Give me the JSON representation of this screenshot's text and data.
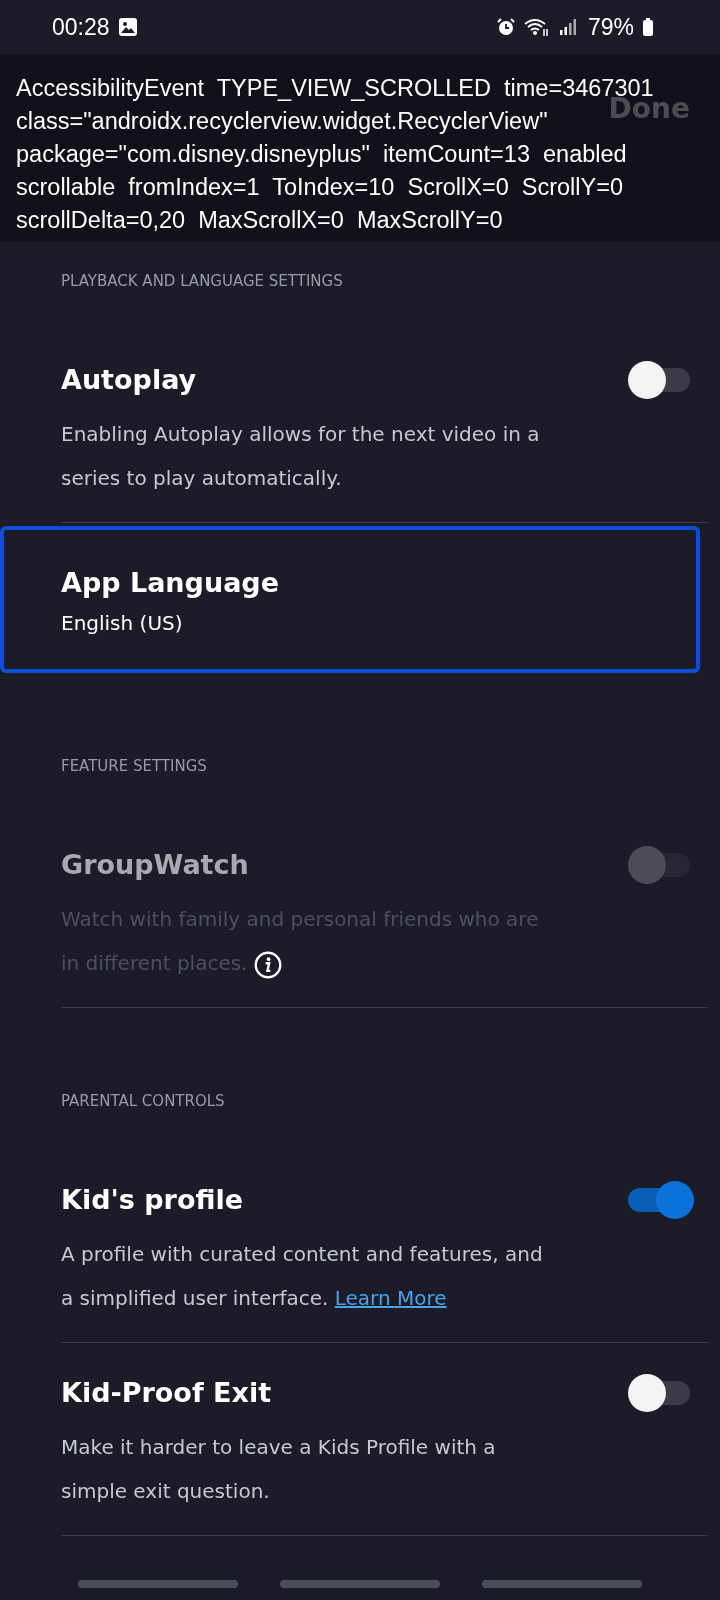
{
  "status_bar": {
    "time": "00:28",
    "battery": "79%"
  },
  "header": {
    "action": "Done"
  },
  "debug_overlay": {
    "lines": [
      "AccessibilityEvent  TYPE_VIEW_SCROLLED  time=3467301",
      "class=\"androidx.recyclerview.widget.RecyclerView\"",
      "package=\"com.disney.disneyplus\"  itemCount=13  enabled",
      "scrollable  fromIndex=1  ToIndex=10  ScrollX=0  ScrollY=0",
      "scrollDelta=0,20  MaxScrollX=0  MaxScrollY=0"
    ]
  },
  "sections": [
    {
      "heading": "PLAYBACK AND LANGUAGE SETTINGS",
      "items": [
        {
          "kind": "toggle",
          "title": "Autoplay",
          "description": "Enabling Autoplay allows for the next video in a series to play automatically.",
          "on": false,
          "disabled": false,
          "focused": false
        },
        {
          "kind": "value",
          "title": "App Language",
          "value": "English (US)",
          "focused": true
        }
      ]
    },
    {
      "heading": "FEATURE SETTINGS",
      "items": [
        {
          "kind": "toggle",
          "title": "GroupWatch",
          "description": "Watch with family and personal friends who are in different places.",
          "info_icon": true,
          "on": false,
          "disabled": true,
          "focused": false
        }
      ]
    },
    {
      "heading": "PARENTAL CONTROLS",
      "items": [
        {
          "kind": "toggle",
          "title": "Kid's profile",
          "description": "A profile with curated content and features, and a simplified user interface.",
          "link": "Learn More",
          "on": true,
          "disabled": false,
          "focused": false
        },
        {
          "kind": "toggle",
          "title": "Kid-Proof Exit",
          "description": "Make it harder to leave a Kids Profile with a simple exit question.",
          "on": false,
          "disabled": false,
          "focused": false
        }
      ]
    }
  ]
}
